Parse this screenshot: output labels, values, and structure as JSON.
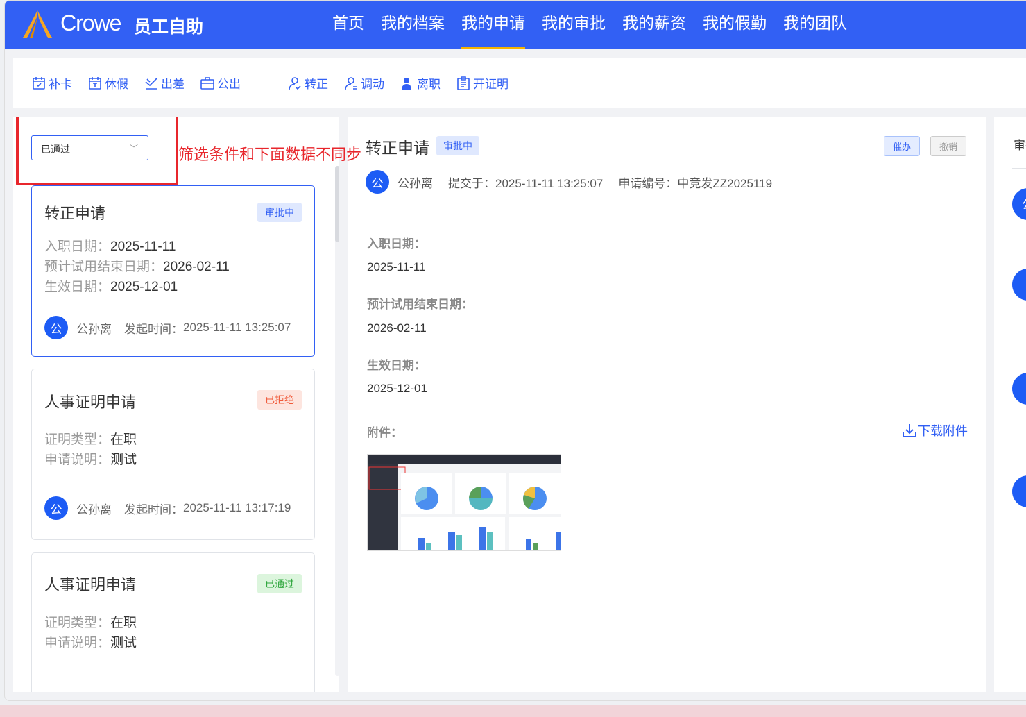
{
  "header": {
    "brand": "Crowe",
    "subtitle": "员工自助",
    "nav": [
      "首页",
      "我的档案",
      "我的申请",
      "我的审批",
      "我的薪资",
      "我的假勤",
      "我的团队"
    ],
    "active": "我的申请"
  },
  "toolbar": [
    {
      "label": "补卡",
      "icon": "calendar-check-icon"
    },
    {
      "label": "休假",
      "icon": "calendar-leave-icon"
    },
    {
      "label": "出差",
      "icon": "plane-icon"
    },
    {
      "label": "公出",
      "icon": "briefcase-icon"
    },
    {
      "label": "转正",
      "icon": "user-check-icon"
    },
    {
      "label": "调动",
      "icon": "user-transfer-icon"
    },
    {
      "label": "离职",
      "icon": "user-leave-icon"
    },
    {
      "label": "开证明",
      "icon": "clipboard-icon"
    }
  ],
  "filter": {
    "value": "已通过"
  },
  "annotation": "筛选条件和下面数据不同步",
  "cards": [
    {
      "title": "转正申请",
      "status": "审批中",
      "fields": [
        [
          "入职日期：",
          "2025-11-11"
        ],
        [
          "预计试用结束日期：",
          "2026-02-11"
        ],
        [
          "生效日期：",
          "2025-12-01"
        ]
      ],
      "avatar": "公",
      "name": "公孙离",
      "time_label": "发起时间：",
      "time": "2025-11-11 13:25:07"
    },
    {
      "title": "人事证明申请",
      "status": "已拒绝",
      "fields": [
        [
          "证明类型：",
          "在职"
        ],
        [
          "申请说明：",
          "测试"
        ]
      ],
      "avatar": "公",
      "name": "公孙离",
      "time_label": "发起时间：",
      "time": "2025-11-11 13:17:19"
    },
    {
      "title": "人事证明申请",
      "status": "已通过",
      "fields": [
        [
          "证明类型：",
          "在职"
        ],
        [
          "申请说明：",
          "测试"
        ]
      ]
    }
  ],
  "detail": {
    "title": "转正申请",
    "status": "审批中",
    "urge": "催办",
    "cancel": "撤销",
    "avatar": "公",
    "name": "公孙离",
    "submitted": "提交于：2025-11-11 13:25:07",
    "number": "申请编号：中竞发ZZ2025119",
    "fields": [
      [
        "入职日期：",
        "2025-11-11"
      ],
      [
        "预计试用结束日期：",
        "2026-02-11"
      ],
      [
        "生效日期：",
        "2025-12-01"
      ]
    ],
    "attachment_label": "附件：",
    "download": "下载附件"
  },
  "right": {
    "title": "审批",
    "avatar": "公"
  }
}
